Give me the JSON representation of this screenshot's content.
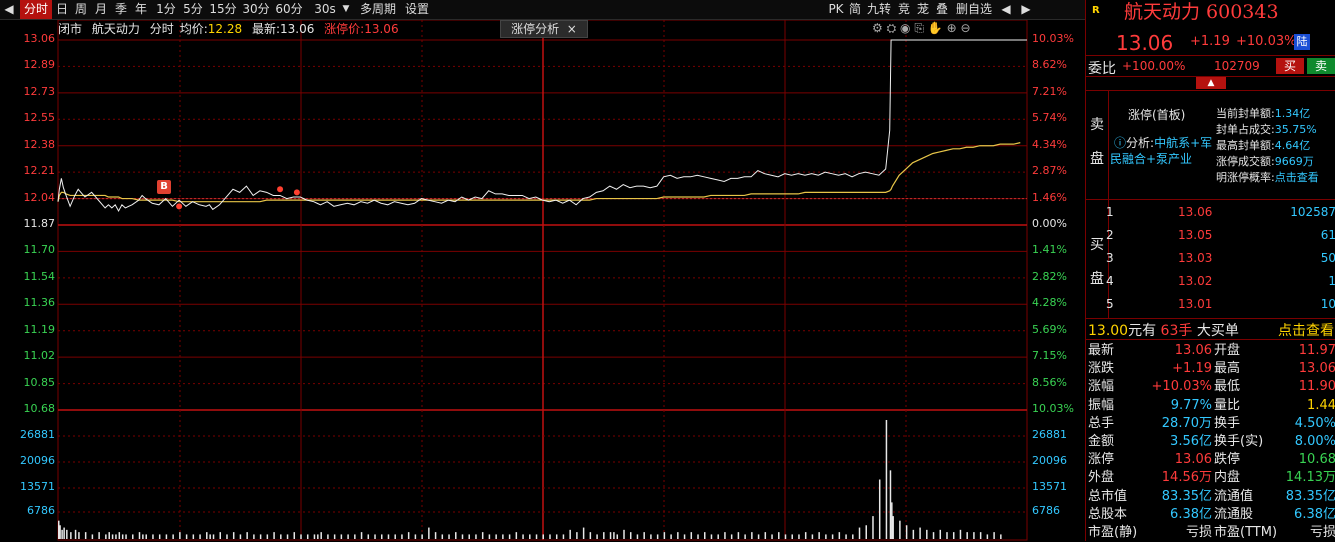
{
  "toolbar": {
    "nav_prev": "◀",
    "periods": [
      "分时",
      "日",
      "周",
      "月",
      "季",
      "年",
      "1分",
      "5分",
      "15分",
      "30分",
      "60分",
      "30s"
    ],
    "multi_period": "多周期",
    "settings": "设置",
    "right_items": [
      "PK",
      "简",
      "九转",
      "竞",
      "茏",
      "叠",
      "删自选"
    ],
    "nav_prev2": "◀",
    "nav_next": "▶"
  },
  "info": {
    "status": "闭市",
    "name": "航天动力",
    "mode": "分时",
    "avg_label": "均价:",
    "avg_value": "12.28",
    "latest_label": "最新:",
    "latest_value": "13.06",
    "limit_label": "涨停价:",
    "limit_value": "13.06"
  },
  "zt_tab": {
    "label": "涨停分析",
    "close": "×"
  },
  "left_axis": [
    "13.06",
    "12.89",
    "12.73",
    "12.55",
    "12.38",
    "12.21",
    "12.04",
    "11.87",
    "11.70",
    "11.54",
    "11.36",
    "11.19",
    "11.02",
    "10.85",
    "10.68"
  ],
  "right_axis": [
    "10.03%",
    "8.62%",
    "7.21%",
    "5.74%",
    "4.34%",
    "2.87%",
    "1.46%",
    "0.00%",
    "1.41%",
    "2.82%",
    "4.28%",
    "5.69%",
    "7.15%",
    "8.56%",
    "10.03%"
  ],
  "vol_axis": [
    "26881",
    "20096",
    "13571",
    "6786"
  ],
  "marker_label": "B",
  "chart_data": {
    "type": "line",
    "ylim": [
      10.68,
      13.06
    ],
    "prev_close": 11.87,
    "x": [
      0,
      2,
      5,
      8,
      12,
      18,
      25,
      30,
      40,
      50,
      60,
      70,
      75,
      80,
      85,
      90,
      95,
      100,
      110,
      120,
      125,
      130,
      140,
      150,
      160,
      170,
      180,
      190,
      200,
      210,
      220,
      225,
      230,
      240,
      250,
      260,
      270,
      280,
      290,
      300,
      310,
      320,
      330,
      340,
      350,
      360,
      370,
      380,
      385,
      390,
      400,
      410,
      420,
      430,
      440,
      450,
      460,
      470,
      480,
      490,
      500,
      510,
      520,
      530,
      540,
      550,
      560,
      570,
      580,
      590,
      600,
      610,
      620,
      630,
      640,
      650,
      660,
      670,
      680,
      690,
      700,
      710,
      720,
      730,
      740,
      750,
      760,
      770,
      780,
      790,
      800,
      810,
      820,
      825,
      830,
      840,
      850,
      860,
      870,
      880,
      890,
      900,
      910,
      920,
      930,
      940,
      950,
      960,
      970,
      980,
      990,
      1000,
      1010,
      1020,
      1030,
      1040,
      1050,
      1060,
      1070,
      1080,
      1090,
      1100,
      1110,
      1120,
      1130,
      1140,
      1150,
      1160,
      1170,
      1180,
      1190,
      1200,
      1210,
      1220,
      1230,
      1236,
      1238,
      1240,
      1250,
      1260,
      1270,
      1280,
      1290,
      1300,
      1310,
      1320,
      1330,
      1340,
      1350,
      1360,
      1370,
      1380,
      1390,
      1400,
      1410,
      1420,
      1430,
      1440
    ],
    "series": [
      {
        "values": [
          12.02,
          12.1,
          12.17,
          12.11,
          12.06,
          11.99,
          12.06,
          12.1,
          12.05,
          12.08,
          12.03,
          11.98,
          12.0,
          11.98,
          12.0,
          11.96,
          12.0,
          11.98,
          12.0,
          12.03,
          12.06,
          12.04,
          12.01,
          12.0,
          12.04,
          11.99,
          12.03,
          11.99,
          12.02,
          12.0,
          11.99,
          12.0,
          11.97,
          12.0,
          12.05,
          12.1,
          12.08,
          12.12,
          12.06,
          12.09,
          12.08,
          12.06,
          12.06,
          12.04,
          12.05,
          12.05,
          12.03,
          12.02,
          12.01,
          12.0,
          12.02,
          11.99,
          12.0,
          12.01,
          12.0,
          12.02,
          12.01,
          12.03,
          12.01,
          12.0,
          12.02,
          12.01,
          12.0,
          12.01,
          12.04,
          12.03,
          12.02,
          12.01,
          12.03,
          12.02,
          12.05,
          12.03,
          12.05,
          12.04,
          12.09,
          12.07,
          12.07,
          12.06,
          12.06,
          12.06,
          12.04,
          12.05,
          12.03,
          12.02,
          12.03,
          12.01,
          12.03,
          12.0,
          12.04,
          12.05,
          12.08,
          12.09,
          12.12,
          12.11,
          12.1,
          12.13,
          12.11,
          12.12,
          12.12,
          12.11,
          12.12,
          12.18,
          12.19,
          12.17,
          12.18,
          12.18,
          12.19,
          12.18,
          12.17,
          12.16,
          12.15,
          12.17,
          12.17,
          12.18,
          12.18,
          12.22,
          12.2,
          12.19,
          12.18,
          12.2,
          12.19,
          12.2,
          12.19,
          12.2,
          12.19,
          12.21,
          12.2,
          12.19,
          12.2,
          12.18,
          12.2,
          12.21,
          12.2,
          12.19,
          12.23,
          12.48,
          13.06,
          13.06,
          13.06,
          13.06,
          13.06,
          13.06,
          13.06,
          13.06,
          13.06,
          13.06,
          13.06,
          13.06,
          13.06,
          13.06,
          13.06,
          13.06,
          13.06,
          13.06,
          13.06,
          13.06,
          13.06,
          13.06,
          13.06
        ]
      },
      {
        "values": [
          12.02,
          12.06,
          12.08,
          12.08,
          12.07,
          12.06,
          12.06,
          12.06,
          12.06,
          12.06,
          12.06,
          12.06,
          12.05,
          12.05,
          12.05,
          12.05,
          12.04,
          12.04,
          12.04,
          12.03,
          12.03,
          12.03,
          12.03,
          12.03,
          12.03,
          12.03,
          12.02,
          12.02,
          12.02,
          12.02,
          12.02,
          12.02,
          12.02,
          12.02,
          12.02,
          12.02,
          12.02,
          12.02,
          12.02,
          12.02,
          12.03,
          12.03,
          12.03,
          12.03,
          12.03,
          12.03,
          12.03,
          12.03,
          12.03,
          12.03,
          12.03,
          12.03,
          12.03,
          12.03,
          12.03,
          12.03,
          12.03,
          12.03,
          12.03,
          12.03,
          12.03,
          12.03,
          12.03,
          12.03,
          12.03,
          12.03,
          12.03,
          12.03,
          12.03,
          12.03,
          12.03,
          12.03,
          12.03,
          12.03,
          12.03,
          12.03,
          12.03,
          12.03,
          12.03,
          12.03,
          12.03,
          12.03,
          12.03,
          12.03,
          12.03,
          12.03,
          12.03,
          12.03,
          12.03,
          12.03,
          12.04,
          12.04,
          12.04,
          12.04,
          12.04,
          12.04,
          12.04,
          12.04,
          12.04,
          12.04,
          12.04,
          12.05,
          12.05,
          12.05,
          12.05,
          12.05,
          12.05,
          12.05,
          12.06,
          12.06,
          12.06,
          12.06,
          12.06,
          12.06,
          12.07,
          12.07,
          12.07,
          12.07,
          12.07,
          12.07,
          12.07,
          12.07,
          12.08,
          12.08,
          12.08,
          12.08,
          12.08,
          12.08,
          12.08,
          12.08,
          12.08,
          12.08,
          12.08,
          12.08,
          12.08,
          12.09,
          12.1,
          12.12,
          12.19,
          12.23,
          12.27,
          12.29,
          12.31,
          12.33,
          12.34,
          12.35,
          12.36,
          12.36,
          12.37,
          12.37,
          12.38,
          12.38,
          12.38,
          12.39,
          12.39,
          12.39,
          12.4
        ]
      }
    ],
    "volume": [
      8,
      6,
      4,
      5,
      4,
      3,
      4,
      3,
      3,
      2,
      3,
      2,
      3,
      2,
      2,
      3,
      2,
      2,
      2,
      3,
      2,
      2,
      2,
      2,
      2,
      2,
      3,
      2,
      2,
      2,
      3,
      2,
      2,
      3,
      2,
      3,
      2,
      3,
      2,
      2,
      2,
      3,
      2,
      2,
      3,
      2,
      2,
      2,
      2,
      3,
      2,
      2,
      2,
      2,
      2,
      3,
      2,
      2,
      2,
      2,
      2,
      2,
      3,
      2,
      2,
      5,
      3,
      2,
      2,
      3,
      2,
      2,
      2,
      3,
      2,
      2,
      2,
      2,
      3,
      2,
      2,
      2,
      2,
      2,
      2,
      2,
      4,
      3,
      5,
      3,
      2,
      3,
      3,
      3,
      2,
      4,
      3,
      2,
      3,
      2,
      2,
      3,
      2,
      3,
      2,
      3,
      2,
      3,
      2,
      2,
      3,
      2,
      3,
      2,
      3,
      2,
      3,
      2,
      3,
      2,
      2,
      2,
      3,
      2,
      3,
      2,
      2,
      3,
      2,
      2,
      5,
      6,
      10,
      26,
      52,
      30,
      16,
      10,
      8,
      6,
      4,
      5,
      4,
      3,
      4,
      3,
      3,
      4,
      3,
      3,
      3,
      2,
      3,
      2
    ]
  },
  "rp": {
    "badge": "R",
    "title": "航天动力 600343",
    "price": "13.06",
    "change": "+1.19",
    "pct": "+10.03%",
    "market": "陆",
    "wb_label": "委比",
    "wb_value": "+100.00%",
    "wb_vol": "102709",
    "buy": "买",
    "sell": "卖",
    "sell_side": "卖\n盘",
    "zt_title": "涨停(首板)",
    "analysis": "分析:",
    "analysis_text1": "中航系+军",
    "analysis_text2": "民融合+泵产业",
    "stats": [
      {
        "label": "当前封单额:",
        "value": "1.34亿"
      },
      {
        "label": "封单占成交:",
        "value": "35.75%"
      },
      {
        "label": "最高封单额:",
        "value": "4.64亿"
      },
      {
        "label": "涨停成交额:",
        "value": "9669万"
      },
      {
        "label": "明涨停概率:",
        "value": "点击查看"
      }
    ],
    "buy_side": "买\n盘",
    "bids": [
      {
        "lvl": "1",
        "price": "13.06",
        "vol": "102587"
      },
      {
        "lvl": "2",
        "price": "13.05",
        "vol": "61"
      },
      {
        "lvl": "3",
        "price": "13.03",
        "vol": "50"
      },
      {
        "lvl": "4",
        "price": "13.02",
        "vol": "1"
      },
      {
        "lvl": "5",
        "price": "13.01",
        "vol": "10"
      }
    ],
    "big_order": {
      "price": "13.00",
      "unit": "元有",
      "hand": "63手",
      "type": "大买单",
      "action": "点击查看"
    },
    "quotes": [
      {
        "l1": "最新",
        "v1": "13.06",
        "c1": "r",
        "l2": "开盘",
        "v2": "11.97",
        "c2": "r"
      },
      {
        "l1": "涨跌",
        "v1": "+1.19",
        "c1": "r",
        "l2": "最高",
        "v2": "13.06",
        "c2": "r"
      },
      {
        "l1": "涨幅",
        "v1": "+10.03%",
        "c1": "r",
        "l2": "最低",
        "v2": "11.90",
        "c2": "r"
      },
      {
        "l1": "振幅",
        "v1": "9.77%",
        "c1": "c",
        "l2": "量比",
        "v2": "1.44",
        "c2": "y"
      },
      {
        "l1": "总手",
        "v1": "28.70万",
        "c1": "c",
        "l2": "换手",
        "v2": "4.50%",
        "c2": "c"
      },
      {
        "l1": "金额",
        "v1": "3.56亿",
        "c1": "c",
        "l2": "换手(实)",
        "v2": "8.00%",
        "c2": "c"
      },
      {
        "l1": "涨停",
        "v1": "13.06",
        "c1": "r",
        "l2": "跌停",
        "v2": "10.68",
        "c2": "g"
      },
      {
        "l1": "外盘",
        "v1": "14.56万",
        "c1": "r",
        "l2": "内盘",
        "v2": "14.13万",
        "c2": "g"
      },
      {
        "l1": "总市值",
        "v1": "83.35亿",
        "c1": "c",
        "l2": "流通值",
        "v2": "83.35亿",
        "c2": "c"
      },
      {
        "l1": "总股本",
        "v1": "6.38亿",
        "c1": "c",
        "l2": "流通股",
        "v2": "6.38亿",
        "c2": "c"
      },
      {
        "l1": "市盈(静)",
        "v1": "亏损",
        "c1": "w",
        "l2": "市盈(TTM)",
        "v2": "亏损",
        "c2": "w"
      }
    ]
  }
}
